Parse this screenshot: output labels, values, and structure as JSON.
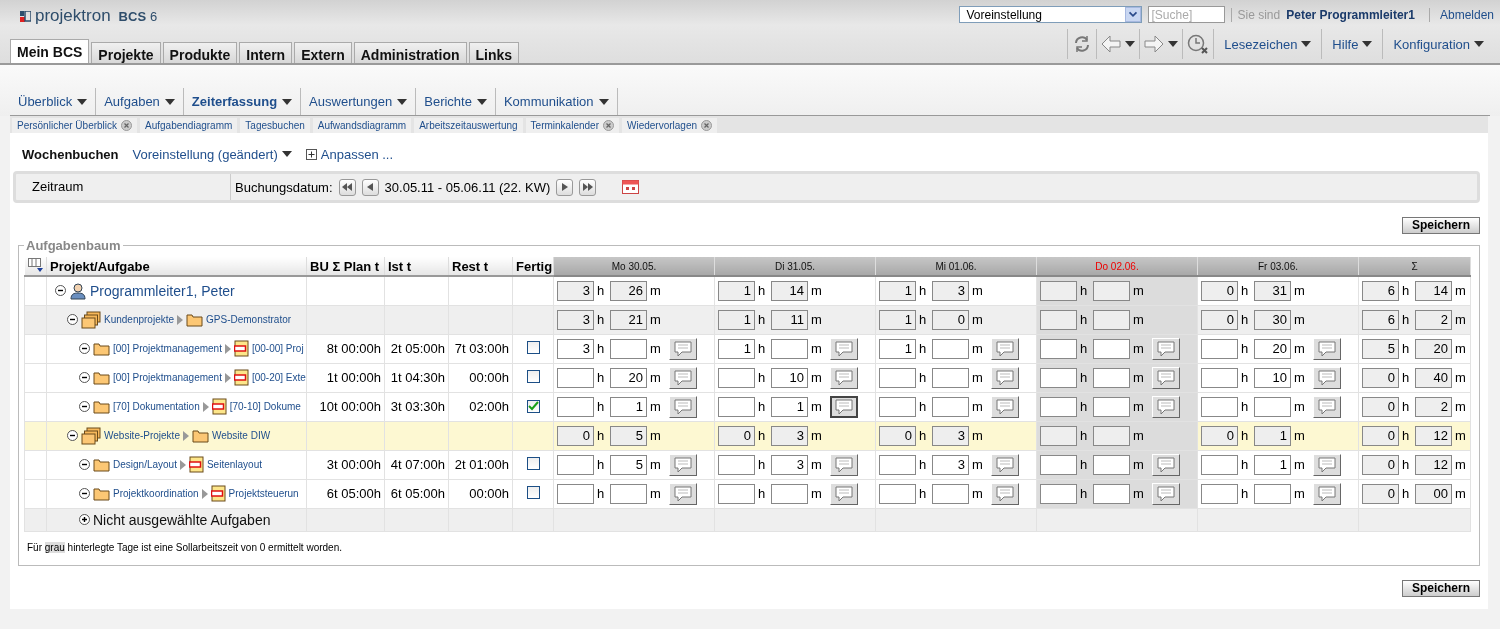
{
  "brand": {
    "name": "projektron",
    "product": "BCS",
    "version": "6"
  },
  "main_tabs": [
    {
      "label": "Mein BCS",
      "selected": true
    },
    {
      "label": "Projekte",
      "selected": false
    },
    {
      "label": "Produkte",
      "selected": false
    },
    {
      "label": "Intern",
      "selected": false
    },
    {
      "label": "Extern",
      "selected": false
    },
    {
      "label": "Administration",
      "selected": false
    },
    {
      "label": "Links",
      "selected": false
    }
  ],
  "top_bar": {
    "preset": "Voreinstellung",
    "search_placeholder": "[Suche]",
    "user_prefix": "Sie sind",
    "user": "Peter Programmleiter1",
    "logout": "Abmelden"
  },
  "toolbar_menus": [
    "Lesezeichen",
    "Hilfe",
    "Konfiguration"
  ],
  "sub_menu": [
    {
      "label": "Überblick",
      "selected": false
    },
    {
      "label": "Aufgaben",
      "selected": false
    },
    {
      "label": "Zeiterfassung",
      "selected": true
    },
    {
      "label": "Auswertungen",
      "selected": false
    },
    {
      "label": "Berichte",
      "selected": false
    },
    {
      "label": "Kommunikation",
      "selected": false
    }
  ],
  "page_tabs": [
    {
      "label": "Persönlicher Überblick",
      "closable": true
    },
    {
      "label": "Aufgabendiagramm",
      "closable": false
    },
    {
      "label": "Tagesbuchen",
      "closable": false
    },
    {
      "label": "Aufwandsdiagramm",
      "closable": false
    },
    {
      "label": "Arbeitszeitauswertung",
      "closable": false
    },
    {
      "label": "Terminkalender",
      "closable": true
    },
    {
      "label": "Wiedervorlagen",
      "closable": true
    }
  ],
  "view": {
    "title": "Wochenbuchen",
    "preset": "Voreinstellung (geändert)",
    "customize": "Anpassen ..."
  },
  "period": {
    "label": "Zeitraum",
    "date_label": "Buchungsdatum:",
    "range": "30.05.11 - 05.06.11 (22. KW)"
  },
  "save_top": "Speichern",
  "tree_title": "Aufgabenbaum",
  "columns": [
    "Projekt/Aufgabe",
    "BU Σ Plan t",
    "Ist t",
    "Rest t",
    "Fertig"
  ],
  "day_columns": [
    {
      "label": "Mo 30.05.",
      "kind": "day",
      "off": false
    },
    {
      "label": "Di 31.05.",
      "kind": "day",
      "off": false
    },
    {
      "label": "Mi 01.06.",
      "kind": "day",
      "off": false
    },
    {
      "label": "Do 02.06.",
      "kind": "day",
      "off": true
    },
    {
      "label": "Fr 03.06.",
      "kind": "day",
      "off": false
    },
    {
      "label": "Σ",
      "kind": "sum",
      "off": false
    }
  ],
  "tree": {
    "kind": "person",
    "name": "Programmleiter1, Peter",
    "expanded": true,
    "cells": [
      {
        "h": "3",
        "hu": "h",
        "m": "26",
        "mu": "m"
      },
      {
        "h": "1",
        "hu": "h",
        "m": "14",
        "mu": "m"
      },
      {
        "h": "1",
        "hu": "h",
        "m": "3",
        "mu": "m"
      },
      {
        "hu": "h",
        "mu": "m"
      },
      {
        "h": "0",
        "hu": "h",
        "m": "31",
        "mu": "m"
      },
      {
        "h": "6",
        "hu": "h",
        "m": "14",
        "mu": "m"
      }
    ],
    "children": [
      {
        "kind": "group",
        "parent": "Kundenprojekte",
        "name": "GPS-Demonstrator",
        "expanded": true,
        "highlighted": false,
        "cells": [
          {
            "h": "3",
            "hu": "h",
            "m": "21",
            "mu": "m"
          },
          {
            "h": "1",
            "hu": "h",
            "m": "11",
            "mu": "m"
          },
          {
            "h": "1",
            "hu": "h",
            "m": "0",
            "mu": "m"
          },
          {
            "hu": "h",
            "mu": "m"
          },
          {
            "h": "0",
            "hu": "h",
            "m": "30",
            "mu": "m"
          },
          {
            "h": "6",
            "hu": "h",
            "m": "2",
            "mu": "m"
          }
        ],
        "children": [
          {
            "kind": "task",
            "parent": "[00] Projektmanagement",
            "name": "[00-00] Proj",
            "expanded": true,
            "plan": "8t 00:00h",
            "actual": "2t 05:00h",
            "rest": "7t 03:00h",
            "done": false,
            "cells": [
              {
                "h": "3",
                "hu": "h",
                "mu": "m",
                "note": false
              },
              {
                "h": "1",
                "hu": "h",
                "mu": "m",
                "note": false
              },
              {
                "h": "1",
                "hu": "h",
                "mu": "m",
                "note": false
              },
              {
                "hu": "h",
                "mu": "m",
                "note": false
              },
              {
                "hu": "h",
                "m": "20",
                "mu": "m",
                "note": false
              },
              {
                "h": "5",
                "hu": "h",
                "m": "20",
                "mu": "m"
              }
            ]
          },
          {
            "kind": "task",
            "parent": "[00] Projektmanagement",
            "name": "[00-20] Exte",
            "expanded": true,
            "plan": "1t 00:00h",
            "actual": "1t 04:30h",
            "rest": "00:00h",
            "done": false,
            "cells": [
              {
                "hu": "h",
                "m": "20",
                "mu": "m",
                "note": false
              },
              {
                "hu": "h",
                "m": "10",
                "mu": "m",
                "note": false
              },
              {
                "hu": "h",
                "mu": "m",
                "note": false
              },
              {
                "hu": "h",
                "mu": "m",
                "note": false
              },
              {
                "hu": "h",
                "m": "10",
                "mu": "m",
                "note": false
              },
              {
                "h": "0",
                "hu": "h",
                "m": "40",
                "mu": "m"
              }
            ]
          },
          {
            "kind": "task",
            "parent": "[70] Dokumentation",
            "name": "[70-10] Dokume",
            "expanded": true,
            "plan": "10t 00:00h",
            "actual": "3t 03:30h",
            "rest": "02:00h",
            "done": true,
            "cells": [
              {
                "hu": "h",
                "m": "1",
                "mu": "m",
                "note": false
              },
              {
                "hu": "h",
                "m": "1",
                "mu": "m",
                "note": true
              },
              {
                "hu": "h",
                "mu": "m",
                "note": false
              },
              {
                "hu": "h",
                "mu": "m",
                "note": false
              },
              {
                "hu": "h",
                "mu": "m",
                "note": false
              },
              {
                "h": "0",
                "hu": "h",
                "m": "2",
                "mu": "m"
              }
            ]
          }
        ]
      },
      {
        "kind": "group",
        "parent": "Website-Projekte",
        "name": "Website DIW",
        "expanded": true,
        "highlighted": true,
        "cells": [
          {
            "h": "0",
            "hu": "h",
            "m": "5",
            "mu": "m"
          },
          {
            "h": "0",
            "hu": "h",
            "m": "3",
            "mu": "m"
          },
          {
            "h": "0",
            "hu": "h",
            "m": "3",
            "mu": "m"
          },
          {
            "hu": "h",
            "mu": "m"
          },
          {
            "h": "0",
            "hu": "h",
            "m": "1",
            "mu": "m"
          },
          {
            "h": "0",
            "hu": "h",
            "m": "12",
            "mu": "m"
          }
        ],
        "children": [
          {
            "kind": "task",
            "parent": "Design/Layout",
            "name": "Seitenlayout",
            "expanded": true,
            "plan": "3t 00:00h",
            "actual": "4t 07:00h",
            "rest": "2t 01:00h",
            "done": false,
            "cells": [
              {
                "hu": "h",
                "m": "5",
                "mu": "m",
                "note": false
              },
              {
                "hu": "h",
                "m": "3",
                "mu": "m",
                "note": false
              },
              {
                "hu": "h",
                "m": "3",
                "mu": "m",
                "note": false
              },
              {
                "hu": "h",
                "mu": "m",
                "note": false
              },
              {
                "hu": "h",
                "m": "1",
                "mu": "m",
                "note": false
              },
              {
                "h": "0",
                "hu": "h",
                "m": "12",
                "mu": "m"
              }
            ]
          },
          {
            "kind": "task",
            "parent": "Projektkoordination",
            "name": "Projektsteuerun",
            "expanded": true,
            "plan": "6t 05:00h",
            "actual": "6t 05:00h",
            "rest": "00:00h",
            "done": false,
            "cells": [
              {
                "hu": "h",
                "mu": "m",
                "note": false
              },
              {
                "hu": "h",
                "mu": "m",
                "note": false
              },
              {
                "hu": "h",
                "mu": "m",
                "note": false
              },
              {
                "hu": "h",
                "mu": "m",
                "note": false
              },
              {
                "hu": "h",
                "mu": "m",
                "note": false
              },
              {
                "h": "0",
                "hu": "h",
                "m": "00",
                "mu": "m"
              }
            ]
          }
        ]
      }
    ]
  },
  "unselected": {
    "label": "Nicht ausgewählte Aufgaben",
    "expanded": false
  },
  "footnote": {
    "prefix": "Für",
    "marked": "grau",
    "suffix": "hinterlegte Tage ist eine Sollarbeitszeit von 0 ermittelt worden."
  },
  "save_bottom": "Speichern"
}
